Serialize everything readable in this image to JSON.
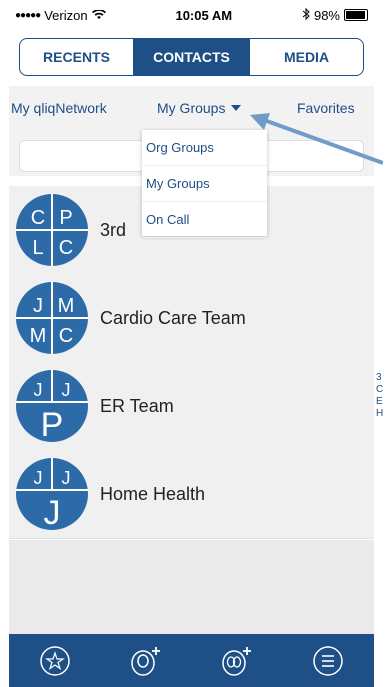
{
  "status_bar": {
    "carrier": "Verizon",
    "time": "10:05 AM",
    "battery": "98%",
    "battery_level": 0.98
  },
  "segments": [
    {
      "label": "RECENTS",
      "active": false
    },
    {
      "label": "CONTACTS",
      "active": true
    },
    {
      "label": "MEDIA",
      "active": false
    }
  ],
  "sub_tabs": {
    "network": "My qliqNetwork",
    "groups": "My Groups",
    "favorites": "Favorites"
  },
  "dropdown": {
    "options": [
      "Org Groups",
      "My Groups",
      "On Call"
    ]
  },
  "groups": [
    {
      "name": "3rd",
      "initials": [
        "C",
        "P",
        "L",
        "C"
      ],
      "style": "quad"
    },
    {
      "name": "Cardio Care Team",
      "initials": [
        "J",
        "M",
        "M",
        "C"
      ],
      "style": "quad"
    },
    {
      "name": "ER Team",
      "initials": [
        "J",
        "J",
        "P"
      ],
      "style": "tri"
    },
    {
      "name": "Home Health",
      "initials": [
        "J",
        "J",
        "J"
      ],
      "style": "tri"
    }
  ],
  "side_clip": {
    "lines": [
      "3",
      "C",
      "E",
      "H"
    ]
  },
  "tab_bar": {
    "icons": [
      "star-icon",
      "add-contact-icon",
      "add-group-icon",
      "menu-icon"
    ]
  },
  "colors": {
    "brand_blue": "#1e4f86",
    "avatar_blue": "#2d6aa8",
    "arrow": "#6f9cc9"
  }
}
